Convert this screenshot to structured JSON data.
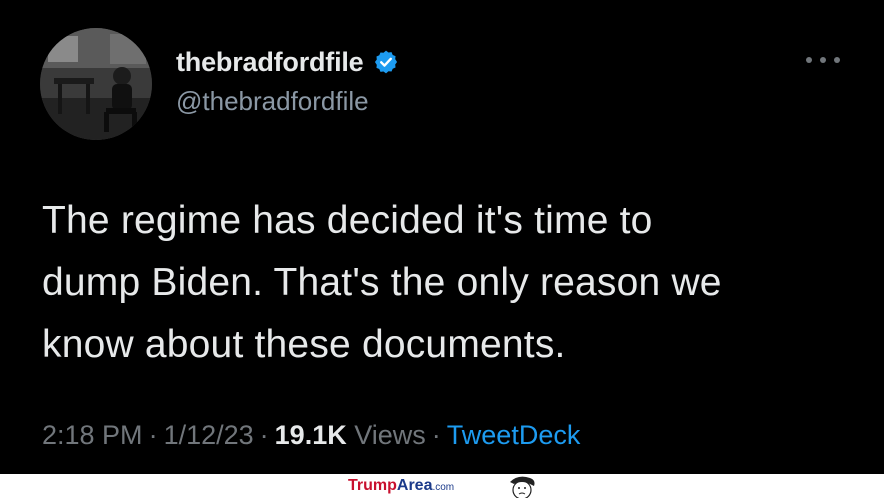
{
  "tweet": {
    "display_name": "thebradfordfile",
    "handle": "@thebradfordfile",
    "verified": true,
    "verified_icon": "verified-badge-icon",
    "text_lines": [
      "The regime has decided it's time to",
      "dump Biden. That's the only reason we",
      "know about these documents."
    ],
    "time": "2:18 PM",
    "date": "1/12/23",
    "views_count": "19.1K",
    "views_label": "Views",
    "source": "TweetDeck",
    "separator": "·",
    "more_icon": "more-horizontal-icon"
  },
  "watermark": {
    "brand_part1": "Trump",
    "brand_part2": "Area",
    "brand_part3": ".com"
  },
  "colors": {
    "background": "#000000",
    "text": "#e7e9ea",
    "secondary_text": "#71767b",
    "link": "#1d9bf0",
    "verified": "#1d9bf0"
  }
}
